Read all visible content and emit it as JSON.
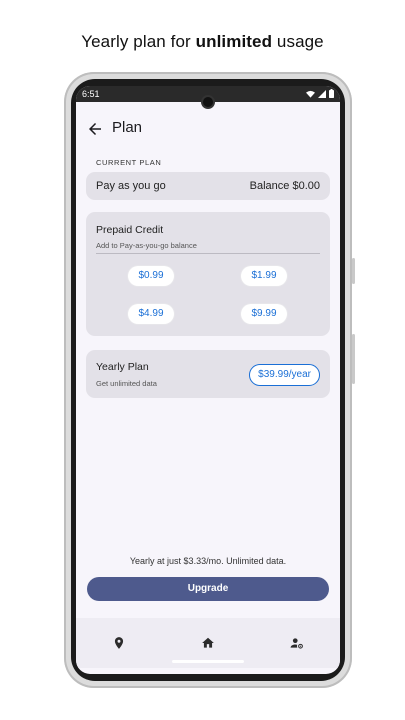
{
  "caption": {
    "pre": "Yearly plan for ",
    "bold": "unlimited",
    "post": " usage"
  },
  "status": {
    "time": "6:51"
  },
  "appbar": {
    "title": "Plan"
  },
  "current_plan": {
    "label": "CURRENT PLAN",
    "name": "Pay as you go",
    "balance": "Balance $0.00"
  },
  "prepaid": {
    "title": "Prepaid Credit",
    "subtitle": "Add to Pay-as-you-go balance",
    "options": [
      "$0.99",
      "$1.99",
      "$4.99",
      "$9.99"
    ]
  },
  "yearly": {
    "title": "Yearly Plan",
    "subtitle": "Get unlimited data",
    "price": "$39.99/year"
  },
  "footer": {
    "note": "Yearly at just $3.33/mo. Unlimited data.",
    "upgrade_label": "Upgrade"
  },
  "nav": {
    "icons": [
      "location-pin-icon",
      "home-icon",
      "account-settings-icon"
    ]
  },
  "colors": {
    "accent": "#1a6fd6",
    "button": "#4e5a8d",
    "card": "#e3e1e8"
  }
}
